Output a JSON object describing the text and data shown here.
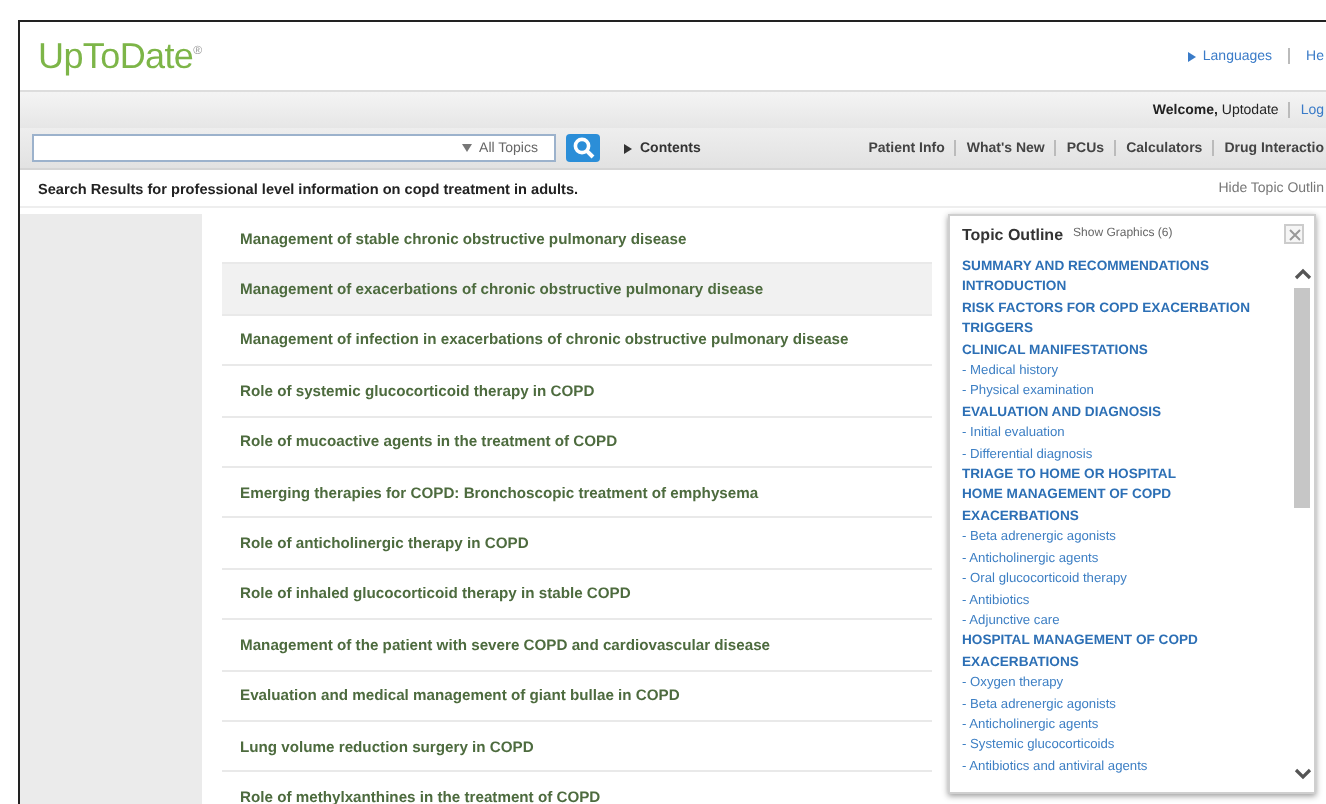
{
  "header": {
    "logo": "UpToDate",
    "logo_mark": "®",
    "links": [
      "Languages",
      "He"
    ]
  },
  "user_bar": {
    "welcome": "Welcome,",
    "user": "Uptodate",
    "link": "Log"
  },
  "search": {
    "scope": "All Topics",
    "contents": "Contents"
  },
  "nav": [
    "Patient Info",
    "What's New",
    "PCUs",
    "Calculators",
    "Drug Interactio"
  ],
  "results_bar": {
    "title": "Search Results for professional level information on copd treatment in adults.",
    "toggle": "Hide Topic Outlin"
  },
  "results": [
    {
      "title": "Management of stable chronic obstructive pulmonary disease",
      "selected": false
    },
    {
      "title": "Management of exacerbations of chronic obstructive pulmonary disease",
      "selected": true
    },
    {
      "title": "Management of infection in exacerbations of chronic obstructive pulmonary disease",
      "selected": false
    },
    {
      "title": "Role of systemic glucocorticoid therapy in COPD",
      "selected": false
    },
    {
      "title": "Role of mucoactive agents in the treatment of COPD",
      "selected": false
    },
    {
      "title": "Emerging therapies for COPD: Bronchoscopic treatment of emphysema",
      "selected": false
    },
    {
      "title": "Role of anticholinergic therapy in COPD",
      "selected": false
    },
    {
      "title": "Role of inhaled glucocorticoid therapy in stable COPD",
      "selected": false
    },
    {
      "title": "Management of the patient with severe COPD and cardiovascular disease",
      "selected": false
    },
    {
      "title": "Evaluation and medical management of giant bullae in COPD",
      "selected": false
    },
    {
      "title": "Lung volume reduction surgery in COPD",
      "selected": false
    },
    {
      "title": "Role of methylxanthines in the treatment of COPD",
      "selected": false
    }
  ],
  "outline": {
    "title": "Topic Outline",
    "graphics": "Show Graphics (6)",
    "items": [
      {
        "kind": "heading",
        "text": "SUMMARY AND RECOMMENDATIONS"
      },
      {
        "kind": "heading",
        "text": "INTRODUCTION"
      },
      {
        "kind": "heading",
        "text": "RISK FACTORS FOR COPD EXACERBATION"
      },
      {
        "kind": "heading",
        "text": "TRIGGERS"
      },
      {
        "kind": "heading",
        "text": "CLINICAL MANIFESTATIONS"
      },
      {
        "kind": "sub",
        "text": "- Medical history"
      },
      {
        "kind": "sub",
        "text": "- Physical examination"
      },
      {
        "kind": "heading",
        "text": "EVALUATION AND DIAGNOSIS"
      },
      {
        "kind": "sub",
        "text": "- Initial evaluation"
      },
      {
        "kind": "sub",
        "text": "- Differential diagnosis"
      },
      {
        "kind": "heading",
        "text": "TRIAGE TO HOME OR HOSPITAL"
      },
      {
        "kind": "heading",
        "text": "HOME MANAGEMENT OF COPD EXACERBATIONS"
      },
      {
        "kind": "sub",
        "text": "- Beta adrenergic agonists"
      },
      {
        "kind": "sub",
        "text": "- Anticholinergic agents"
      },
      {
        "kind": "sub",
        "text": "- Oral glucocorticoid therapy"
      },
      {
        "kind": "sub",
        "text": "- Antibiotics"
      },
      {
        "kind": "sub",
        "text": "- Adjunctive care"
      },
      {
        "kind": "heading",
        "text": "HOSPITAL MANAGEMENT OF COPD EXACERBATIONS"
      },
      {
        "kind": "sub",
        "text": "- Oxygen therapy"
      },
      {
        "kind": "sub",
        "text": "- Beta adrenergic agonists"
      },
      {
        "kind": "sub",
        "text": "- Anticholinergic agents"
      },
      {
        "kind": "sub",
        "text": "- Systemic glucocorticoids"
      },
      {
        "kind": "sub",
        "text": "- Antibiotics and antiviral agents"
      }
    ]
  }
}
